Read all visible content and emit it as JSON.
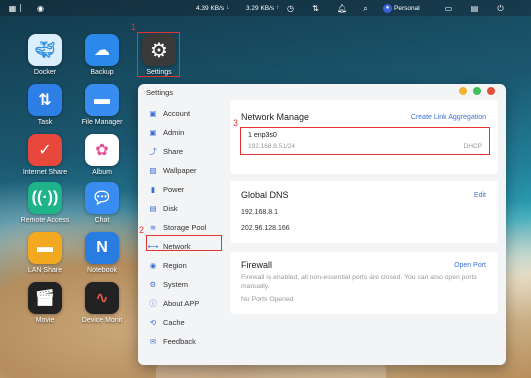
{
  "topbar": {
    "download_speed": "4.39 KB/s",
    "upload_speed": "3.29 KB/s",
    "user_name": "Personal"
  },
  "desktop": {
    "icons": [
      {
        "label": "Docker",
        "icon": "docker-icon",
        "color": "#2f8fe0"
      },
      {
        "label": "Backup",
        "icon": "backup-cloud-icon",
        "color": "#2a89ea"
      },
      {
        "label": "Settings",
        "icon": "gear-icon",
        "color": "#3a3a3a"
      },
      {
        "label": "Task",
        "icon": "task-arrows-icon",
        "color": "#2d7fe6"
      },
      {
        "label": "File Manager",
        "icon": "folder-icon",
        "color": "#3a8df0"
      },
      {
        "label": "Internet Share",
        "icon": "internet-share-icon",
        "color": "#e8473b"
      },
      {
        "label": "Album",
        "icon": "album-flower-icon",
        "color": "#ffffff"
      },
      {
        "label": "Remote Access",
        "icon": "remote-access-icon",
        "color": "#1fb38a"
      },
      {
        "label": "Chat",
        "icon": "chat-icon",
        "color": "#3a8df0"
      },
      {
        "label": "LAN Share",
        "icon": "lan-share-folder-icon",
        "color": "#f2a81f"
      },
      {
        "label": "Notebook",
        "icon": "notebook-icon",
        "color": "#2a7de0"
      },
      {
        "label": "Movie",
        "icon": "movie-clapper-icon",
        "color": "#222222"
      },
      {
        "label": "Device Monit",
        "icon": "device-monitor-icon",
        "color": "#222222"
      }
    ]
  },
  "annotations": {
    "step1": "1",
    "step2": "2",
    "step3": "3",
    "color": "#e5342f"
  },
  "window": {
    "title": "Settings",
    "controls": {
      "minimize": "#f2b233",
      "maximize": "#3fbf5a",
      "close": "#e74c3c"
    },
    "sidebar": [
      {
        "label": "Account",
        "icon": "account-icon"
      },
      {
        "label": "Admin",
        "icon": "admin-icon"
      },
      {
        "label": "Share",
        "icon": "share-icon"
      },
      {
        "label": "Wallpaper",
        "icon": "wallpaper-icon"
      },
      {
        "label": "Power",
        "icon": "power-icon"
      },
      {
        "label": "Disk",
        "icon": "disk-icon"
      },
      {
        "label": "Storage Pool",
        "icon": "storage-pool-icon"
      },
      {
        "label": "Network",
        "icon": "network-icon"
      },
      {
        "label": "Region",
        "icon": "region-icon"
      },
      {
        "label": "System",
        "icon": "system-icon"
      },
      {
        "label": "About APP",
        "icon": "about-icon"
      },
      {
        "label": "Cache",
        "icon": "cache-icon"
      },
      {
        "label": "Feedback",
        "icon": "feedback-icon"
      }
    ],
    "network_manage": {
      "title": "Network Manage",
      "link": "Create Link Aggregation",
      "interface_name": "1 enp3s0",
      "interface_ip": "192.168.8.51/24",
      "interface_mode": "DHCP"
    },
    "global_dns": {
      "title": "Global DNS",
      "edit": "Edit",
      "dns1": "192.168.8.1",
      "dns2": "202.96.128.166"
    },
    "firewall": {
      "title": "Firewall",
      "link": "Open Port",
      "description": "Firewall is enabled, all non-essential ports are closed. You can also open ports manually.",
      "empty": "No Ports Opened"
    }
  }
}
